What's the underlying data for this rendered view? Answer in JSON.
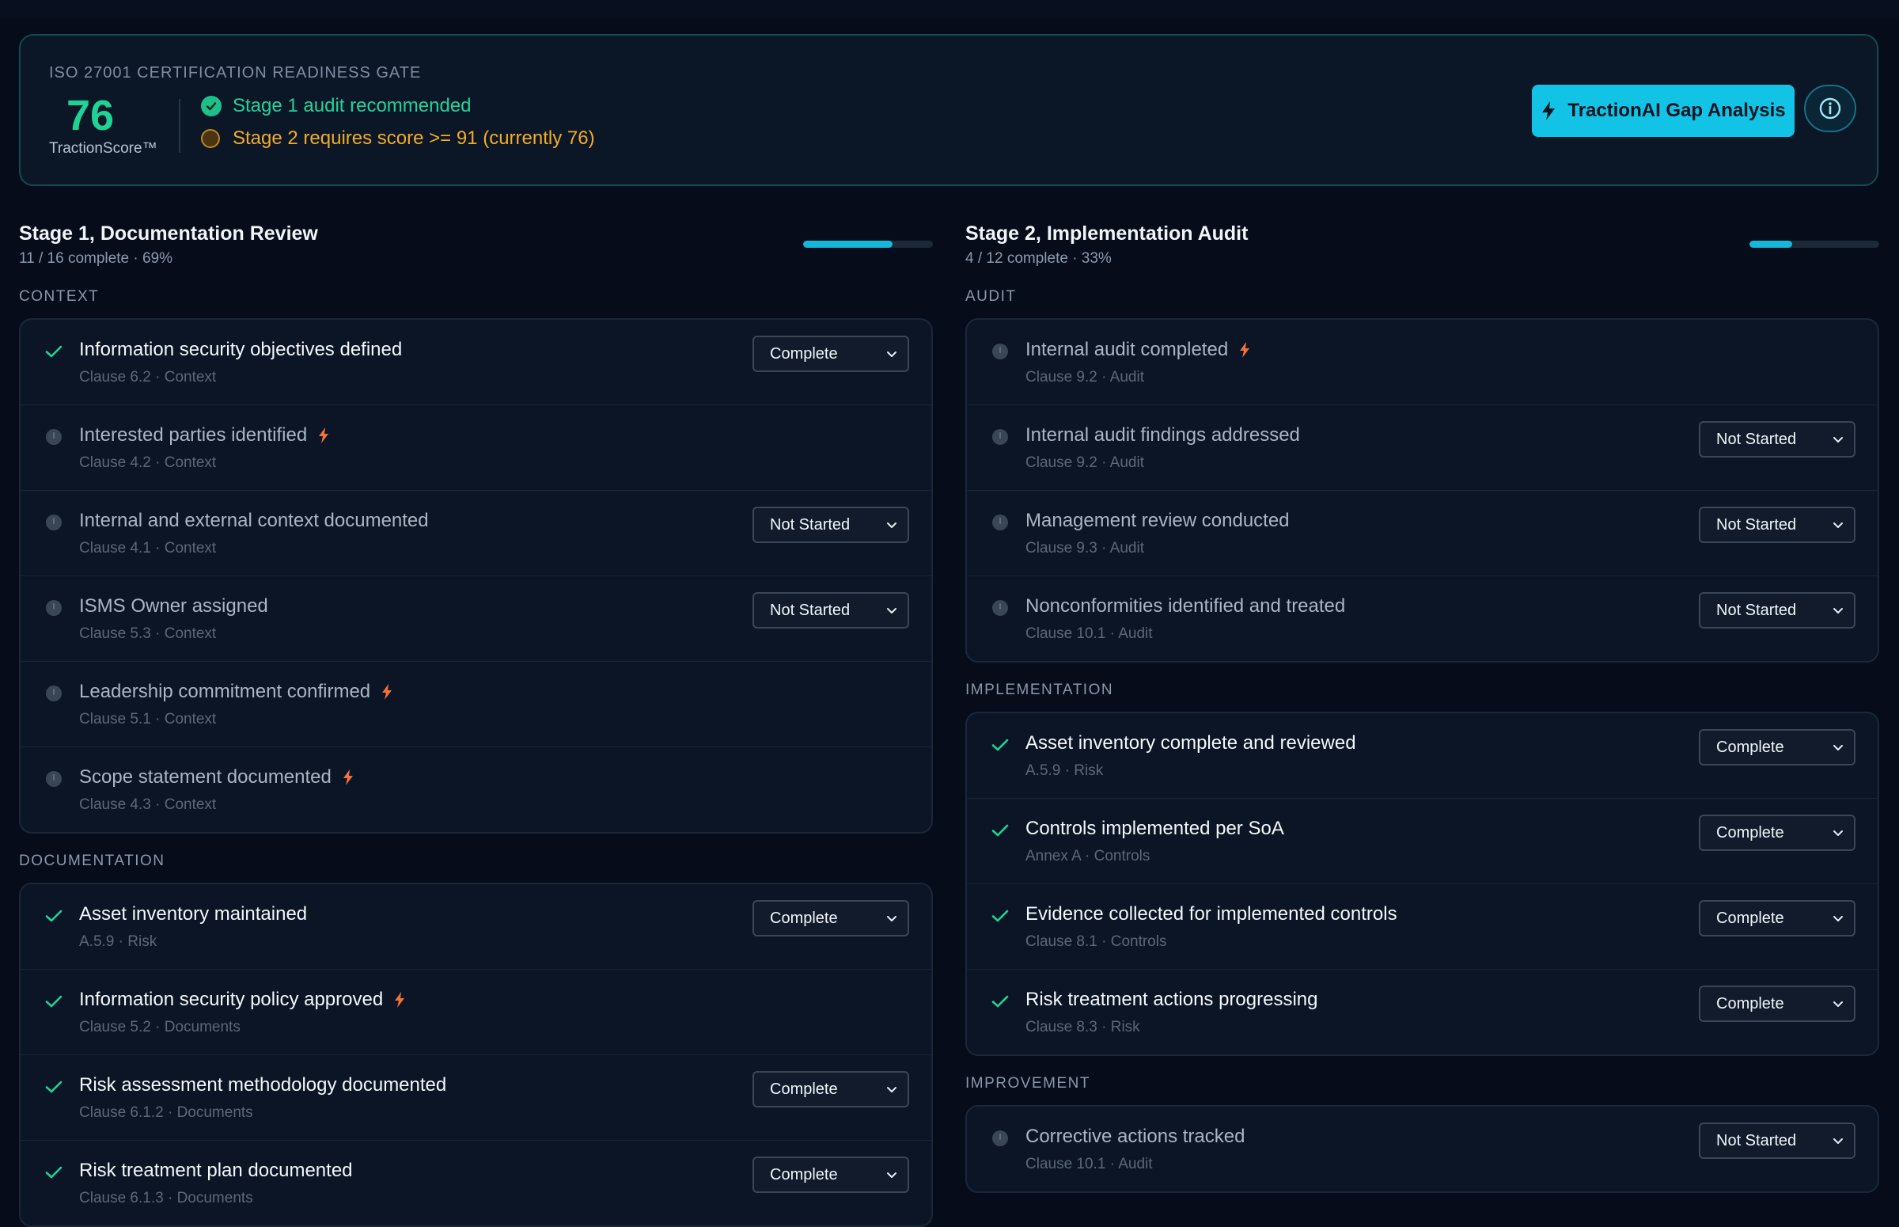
{
  "gate": {
    "title": "ISO 27001 CERTIFICATION READINESS GATE",
    "score": "76",
    "score_label": "TractionScore™",
    "stage1_status": "Stage 1 audit recommended",
    "stage2_status": "Stage 2 requires score >= 91 (currently 76)",
    "gap_button": "TractionAI Gap Analysis"
  },
  "colors": {
    "accent": "#13c3e5",
    "success": "#1fd296",
    "warning": "#f2ab2a",
    "bolt": "#f2733a",
    "background": "#060c19"
  },
  "stage1": {
    "title": "Stage 1, Documentation Review",
    "subtitle": "11 / 16 complete · 69%",
    "progress": 0.69,
    "sections": [
      {
        "label": "CONTEXT",
        "items": [
          {
            "title": "Information security objectives defined",
            "meta": "Clause 6.2 · Context",
            "done": true,
            "flag": false,
            "status": "Complete"
          },
          {
            "title": "Interested parties identified",
            "meta": "Clause 4.2 · Context",
            "done": false,
            "flag": true,
            "status": null
          },
          {
            "title": "Internal and external context documented",
            "meta": "Clause 4.1 · Context",
            "done": false,
            "flag": false,
            "status": "Not Started"
          },
          {
            "title": "ISMS Owner assigned",
            "meta": "Clause 5.3 · Context",
            "done": false,
            "flag": false,
            "status": "Not Started"
          },
          {
            "title": "Leadership commitment confirmed",
            "meta": "Clause 5.1 · Context",
            "done": false,
            "flag": true,
            "status": null
          },
          {
            "title": "Scope statement documented",
            "meta": "Clause 4.3 · Context",
            "done": false,
            "flag": true,
            "status": null
          }
        ]
      },
      {
        "label": "DOCUMENTATION",
        "items": [
          {
            "title": "Asset inventory maintained",
            "meta": "A.5.9 · Risk",
            "done": true,
            "flag": false,
            "status": "Complete"
          },
          {
            "title": "Information security policy approved",
            "meta": "Clause 5.2 · Documents",
            "done": true,
            "flag": true,
            "status": null
          },
          {
            "title": "Risk assessment methodology documented",
            "meta": "Clause 6.1.2 · Documents",
            "done": true,
            "flag": false,
            "status": "Complete"
          },
          {
            "title": "Risk treatment plan documented",
            "meta": "Clause 6.1.3 · Documents",
            "done": true,
            "flag": false,
            "status": "Complete"
          }
        ]
      }
    ]
  },
  "stage2": {
    "title": "Stage 2, Implementation Audit",
    "subtitle": "4 / 12 complete · 33%",
    "progress": 0.33,
    "sections": [
      {
        "label": "AUDIT",
        "items": [
          {
            "title": "Internal audit completed",
            "meta": "Clause 9.2 · Audit",
            "done": false,
            "flag": true,
            "status": null
          },
          {
            "title": "Internal audit findings addressed",
            "meta": "Clause 9.2 · Audit",
            "done": false,
            "flag": false,
            "status": "Not Started"
          },
          {
            "title": "Management review conducted",
            "meta": "Clause 9.3 · Audit",
            "done": false,
            "flag": false,
            "status": "Not Started"
          },
          {
            "title": "Nonconformities identified and treated",
            "meta": "Clause 10.1 · Audit",
            "done": false,
            "flag": false,
            "status": "Not Started"
          }
        ]
      },
      {
        "label": "IMPLEMENTATION",
        "items": [
          {
            "title": "Asset inventory complete and reviewed",
            "meta": "A.5.9 · Risk",
            "done": true,
            "flag": false,
            "status": "Complete"
          },
          {
            "title": "Controls implemented per SoA",
            "meta": "Annex A · Controls",
            "done": true,
            "flag": false,
            "status": "Complete"
          },
          {
            "title": "Evidence collected for implemented controls",
            "meta": "Clause 8.1 · Controls",
            "done": true,
            "flag": false,
            "status": "Complete"
          },
          {
            "title": "Risk treatment actions progressing",
            "meta": "Clause 8.3 · Risk",
            "done": true,
            "flag": false,
            "status": "Complete"
          }
        ]
      },
      {
        "label": "IMPROVEMENT",
        "items": [
          {
            "title": "Corrective actions tracked",
            "meta": "Clause 10.1 · Audit",
            "done": false,
            "flag": false,
            "status": "Not Started"
          }
        ]
      }
    ]
  }
}
